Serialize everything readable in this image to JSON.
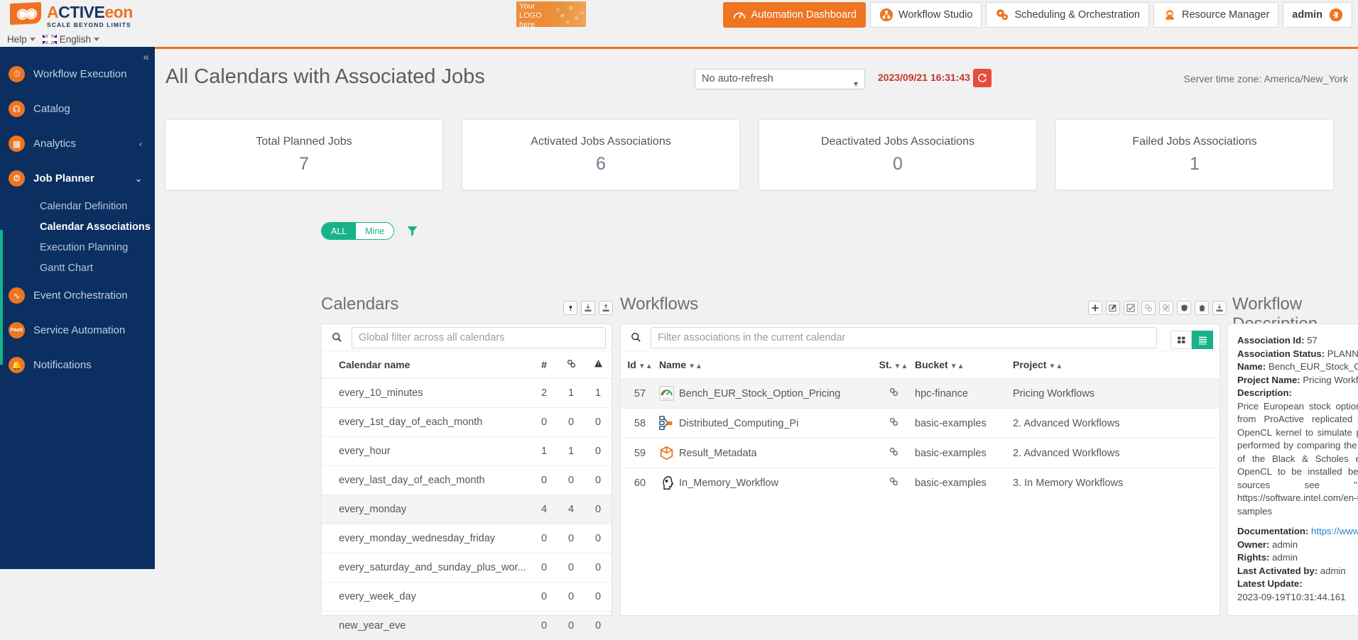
{
  "brand": {
    "name_o": "A",
    "name_full": "CTIVE",
    "name_eon": "eon",
    "tagline": "SCALE BEYOND LIMITS"
  },
  "logo_placeholder": {
    "line1": "Your",
    "line2": "LOGO",
    "line3": "here"
  },
  "nav_tabs": [
    {
      "label": "Automation Dashboard",
      "icon": "gauge-icon",
      "active": true
    },
    {
      "label": "Workflow Studio",
      "icon": "workflow-icon",
      "active": false
    },
    {
      "label": "Scheduling & Orchestration",
      "icon": "gears-icon",
      "active": false
    },
    {
      "label": "Resource Manager",
      "icon": "cloud-icon",
      "active": false
    }
  ],
  "user": {
    "label": "admin",
    "icon": "logout-icon"
  },
  "helpbar": {
    "help": "Help",
    "language": "English"
  },
  "sidebar": {
    "items": [
      {
        "label": "Workflow Execution",
        "icon": "gauge-icon"
      },
      {
        "label": "Catalog",
        "icon": "catalog-icon"
      },
      {
        "label": "Analytics",
        "icon": "analytics-icon",
        "chevron": "‹"
      },
      {
        "label": "Job Planner",
        "icon": "clock-icon",
        "chevron": "⌄",
        "active": true
      }
    ],
    "sub_items": [
      {
        "label": "Calendar Definition",
        "active": false
      },
      {
        "label": "Calendar Associations",
        "active": true
      },
      {
        "label": "Execution Planning",
        "active": false
      },
      {
        "label": "Gantt Chart",
        "active": false
      }
    ],
    "items_after": [
      {
        "label": "Event Orchestration",
        "icon": "pulse-icon"
      },
      {
        "label": "Service Automation",
        "icon": "paas-icon"
      },
      {
        "label": "Notifications",
        "icon": "bell-icon"
      }
    ]
  },
  "page": {
    "title": "All Calendars with Associated Jobs",
    "auto_refresh": "No auto-refresh",
    "timestamp": "2023/09/21 16:31:43",
    "refresh_icon": "refresh-icon",
    "timezone": "Server time zone: America/New_York"
  },
  "cards": [
    {
      "label": "Total Planned Jobs",
      "value": "7"
    },
    {
      "label": "Activated Jobs Associations",
      "value": "6"
    },
    {
      "label": "Deactivated Jobs Associations",
      "value": "0"
    },
    {
      "label": "Failed Jobs Associations",
      "value": "1"
    }
  ],
  "scope_toggle": {
    "all": "ALL",
    "mine": "Mine",
    "filter_icon": "funnel-icon"
  },
  "calendars": {
    "title": "Calendars",
    "tools": [
      "key-icon",
      "import-icon",
      "export-icon"
    ],
    "search_placeholder": "Global filter across all calendars",
    "columns": [
      "Calendar name",
      "#",
      "⚭",
      "⚠"
    ],
    "rows": [
      {
        "name": "every_10_minutes",
        "count": "2",
        "assoc": "1",
        "warn": "1",
        "selected": false
      },
      {
        "name": "every_1st_day_of_each_month",
        "count": "0",
        "assoc": "0",
        "warn": "0",
        "selected": false
      },
      {
        "name": "every_hour",
        "count": "1",
        "assoc": "1",
        "warn": "0",
        "selected": false
      },
      {
        "name": "every_last_day_of_each_month",
        "count": "0",
        "assoc": "0",
        "warn": "0",
        "selected": false
      },
      {
        "name": "every_monday",
        "count": "4",
        "assoc": "4",
        "warn": "0",
        "selected": true
      },
      {
        "name": "every_monday_wednesday_friday",
        "count": "0",
        "assoc": "0",
        "warn": "0",
        "selected": false
      },
      {
        "name": "every_saturday_and_sunday_plus_wor...",
        "count": "0",
        "assoc": "0",
        "warn": "0",
        "selected": false
      },
      {
        "name": "every_week_day",
        "count": "0",
        "assoc": "0",
        "warn": "0",
        "selected": false
      },
      {
        "name": "new_year_eve",
        "count": "0",
        "assoc": "0",
        "warn": "0",
        "selected": false
      }
    ]
  },
  "workflows": {
    "title": "Workflows",
    "tools": [
      "add-icon",
      "edit-icon",
      "check-icon",
      "link-icon",
      "unlink-icon",
      "shield-icon",
      "delete-icon",
      "export-icon"
    ],
    "search_placeholder": "Filter associations in the current calendar",
    "view_grid_icon": "grid-view-icon",
    "view_list_icon": "list-view-icon",
    "columns": [
      "Id",
      "Name",
      "St.",
      "Bucket",
      "Project"
    ],
    "rows": [
      {
        "id": "57",
        "name": "Bench_EUR_Stock_Option_Pricing",
        "icon": "gauge-opencl-icon",
        "status": "link-icon",
        "bucket": "hpc-finance",
        "project": "Pricing Workflows",
        "selected": true
      },
      {
        "id": "58",
        "name": "Distributed_Computing_Pi",
        "icon": "distributed-icon",
        "status": "link-icon",
        "bucket": "basic-examples",
        "project": "2. Advanced Workflows",
        "selected": false
      },
      {
        "id": "59",
        "name": "Result_Metadata",
        "icon": "box-icon",
        "status": "link-icon",
        "bucket": "basic-examples",
        "project": "2. Advanced Workflows",
        "selected": false
      },
      {
        "id": "60",
        "name": "In_Memory_Workflow",
        "icon": "head-icon",
        "status": "link-icon",
        "bucket": "basic-examples",
        "project": "3. In Memory Workflows",
        "selected": false
      }
    ]
  },
  "description": {
    "title": "Workflow Description",
    "assoc_id_label": "Association Id:",
    "assoc_id_value": "57",
    "assoc_status_label": "Association Status:",
    "assoc_status_value": "PLANNED",
    "name_label": "Name:",
    "name_value": "Bench_EUR_Stock_Option_Pricing",
    "project_label": "Project Name:",
    "project_value": "Pricing Workflows",
    "description_label": "Description:",
    "description_text": "Price European stock options using Monte Carlo simulations from ProActive replicated tasks. Each task executes an OpenCL kernel to simulate paths of each option. Validation is performed by comparing the results with the analytical solution of the Black & Scholes equation. This workflow requires OpenCL to be installed before execution. For the OpenCL sources see \"intel_ocl_montecarlo.zip\" in https://software.intel.com/en-us/intel-opencl-support/code-samples",
    "documentation_label": "Documentation:",
    "documentation_value": "https://www.khronos.org/opencl/",
    "owner_label": "Owner:",
    "owner_value": "admin",
    "rights_label": "Rights:",
    "rights_value": "admin",
    "last_activated_label": "Last Activated by:",
    "last_activated_value": "admin",
    "latest_update_label": "Latest Update:",
    "latest_update_value": "2023-09-19T10:31:44.161"
  },
  "colors": {
    "brand_orange": "#ee7522",
    "sidebar_navy": "#0b2f60",
    "accent_green": "#16b288",
    "alert_red": "#c0392b"
  }
}
